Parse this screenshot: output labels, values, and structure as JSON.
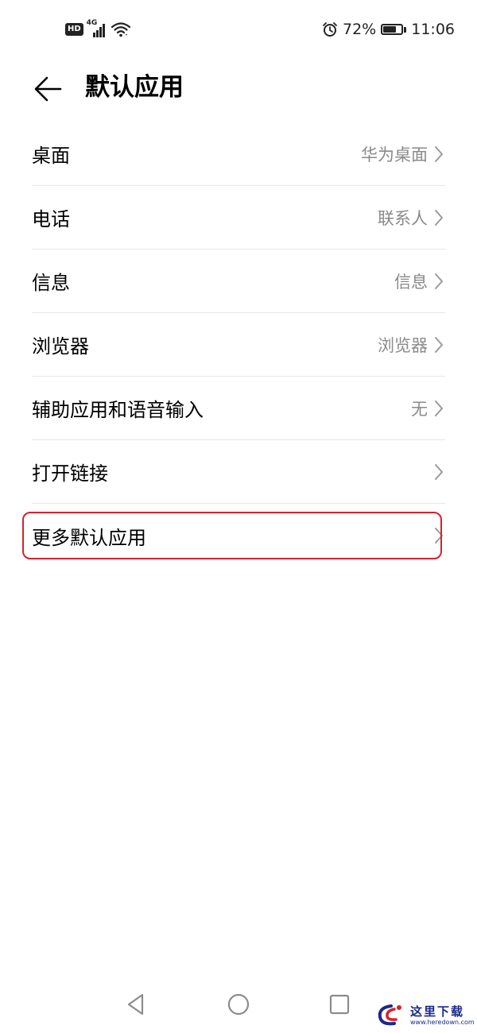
{
  "status_bar": {
    "hd_badge": "HD",
    "network_type": "4G",
    "battery_percent": "72%",
    "battery_level": 0.72,
    "time": "11:06",
    "icons": [
      "hd-icon",
      "signal-icon",
      "wifi-icon",
      "alarm-icon",
      "battery-icon"
    ]
  },
  "header": {
    "title": "默认应用",
    "back_icon": "arrow-left-icon"
  },
  "items": [
    {
      "label": "桌面",
      "value": "华为桌面"
    },
    {
      "label": "电话",
      "value": "联系人"
    },
    {
      "label": "信息",
      "value": "信息"
    },
    {
      "label": "浏览器",
      "value": "浏览器"
    },
    {
      "label": "辅助应用和语音输入",
      "value": "无"
    },
    {
      "label": "打开链接",
      "value": ""
    },
    {
      "label": "更多默认应用",
      "value": ""
    }
  ],
  "nav_bar": {
    "icons": [
      "back-triangle-icon",
      "home-circle-icon",
      "recents-square-icon"
    ]
  },
  "watermark": {
    "text": "这里下载",
    "url": "www.heredown.com"
  },
  "colors": {
    "highlight": "#d9202c",
    "secondary_text": "#8a8a8a",
    "divider": "#e6e6e6"
  }
}
